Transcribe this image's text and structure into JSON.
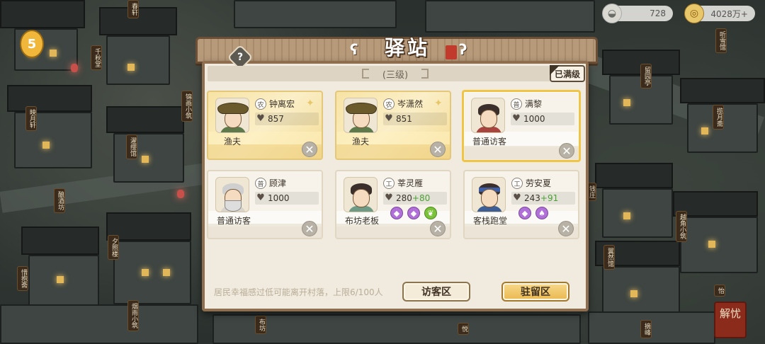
{
  "resources": {
    "silver": {
      "icon": "silver-ingot-icon",
      "value": "728"
    },
    "coins": {
      "icon": "copper-coin-icon",
      "value": "4028万+"
    }
  },
  "panel": {
    "title": "驿站",
    "level": "(三级)",
    "maxed_label": "已满级",
    "hint": "居民幸福感过低可能离开村落，上限6/100人",
    "visitor_button": "访客区",
    "stay_button": "驻留区"
  },
  "residents": [
    {
      "name": "钟离宏",
      "tag": "农",
      "hearts": "857",
      "bonus": "",
      "role": "渔夫",
      "style": "gold"
    },
    {
      "name": "岑潇然",
      "tag": "农",
      "hearts": "851",
      "bonus": "",
      "role": "渔夫",
      "style": "gold"
    },
    {
      "name": "满黎",
      "tag": "普",
      "hearts": "1000",
      "bonus": "",
      "role": "普通访客",
      "style": "selected"
    },
    {
      "name": "顾津",
      "tag": "普",
      "hearts": "1000",
      "bonus": "",
      "role": "普通访客",
      "style": "plain"
    },
    {
      "name": "莘灵雁",
      "tag": "工",
      "hearts": "280",
      "bonus": "+80",
      "role": "布坊老板",
      "style": "plain"
    },
    {
      "name": "劳安夏",
      "tag": "工",
      "hearts": "243",
      "bonus": "+91",
      "role": "客栈跑堂",
      "style": "plain"
    }
  ],
  "map_signs": [
    "春轩",
    "千秋堂",
    "映月轩",
    "锦画小筑",
    "濯缨馆",
    "酿酒坊",
    "夕照楼",
    "惜抱斋",
    "烟雨小筑",
    "布坊",
    "悦",
    "钱庄",
    "留园亭",
    "揽月斋",
    "越角小筑",
    "翼然馆",
    "怡",
    "摘峰",
    "听雪馆"
  ],
  "seal_text": "解忧"
}
